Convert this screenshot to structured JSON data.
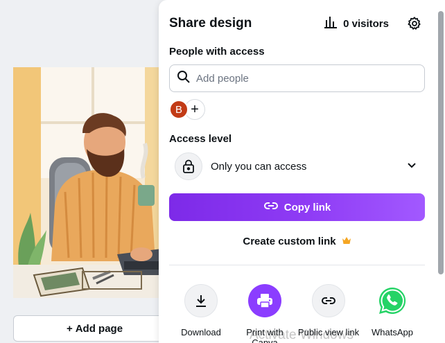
{
  "editor": {
    "add_page_label": "Add page",
    "add_page_icon": "plus-icon"
  },
  "share_panel": {
    "title": "Share design",
    "visitors_label": "0 visitors",
    "visitors_icon": "bar-chart-icon",
    "settings_icon": "gear-icon",
    "people_with_access": {
      "label": "People with access",
      "search_placeholder": "Add people",
      "search_value": "",
      "avatar_initial": "B",
      "avatar_color": "#c23b16",
      "add_person_symbol": "+"
    },
    "access_level": {
      "label": "Access level",
      "value": "Only you can access",
      "icon": "lock-icon"
    },
    "copy_link_label": "Copy link",
    "custom_link_label": "Create custom link",
    "custom_link_icon": "crown-icon",
    "share_options": [
      {
        "label": "Download",
        "icon": "download-icon"
      },
      {
        "label": "Print with Canva",
        "icon": "printer-icon"
      },
      {
        "label": "Public view link",
        "icon": "link-icon"
      },
      {
        "label": "WhatsApp",
        "icon": "whatsapp-icon"
      }
    ],
    "accent_color": "#8b3dff"
  },
  "watermark": "Activate Windows"
}
